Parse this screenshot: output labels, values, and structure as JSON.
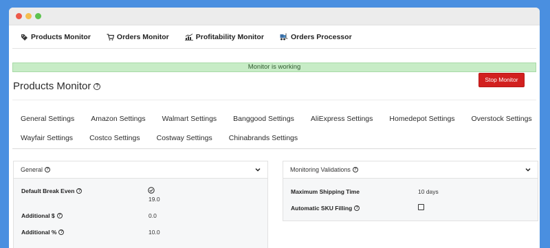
{
  "topnav": [
    {
      "label": "Products Monitor",
      "icon": "tag-icon"
    },
    {
      "label": "Orders Monitor",
      "icon": "cart-icon"
    },
    {
      "label": "Profitability Monitor",
      "icon": "chart-icon"
    },
    {
      "label": "Orders Processor",
      "icon": "forklift-icon"
    }
  ],
  "banner": {
    "text": "Monitor is working"
  },
  "page": {
    "title": "Products Monitor",
    "help": "?"
  },
  "stop_button": {
    "label": "Stop Monitor"
  },
  "settings_tabs": {
    "row1": [
      "General Settings",
      "Amazon Settings",
      "Walmart Settings",
      "Banggood Settings",
      "AliExpress Settings",
      "Homedepot Settings",
      "Overstock Settings"
    ],
    "row2": [
      "Wayfair Settings",
      "Costco Settings",
      "Costway Settings",
      "Chinabrands Settings"
    ]
  },
  "general_panel": {
    "title": "General",
    "rows": [
      {
        "label": "Default Break Even",
        "value": "19.0",
        "has_check_icon": true
      },
      {
        "label": "Additional $",
        "value": "0.0"
      },
      {
        "label": "Additional %",
        "value": "10.0"
      }
    ]
  },
  "validations_panel": {
    "title": "Monitoring Validations",
    "rows": [
      {
        "label": "Maximum Shipping Time",
        "value": "10 days"
      },
      {
        "label": "Automatic SKU Filling",
        "checked": false
      }
    ]
  },
  "colors": {
    "page_bg": "#4a8fe0",
    "banner_bg": "#c7ecc6",
    "stop_button": "#d2201f"
  }
}
